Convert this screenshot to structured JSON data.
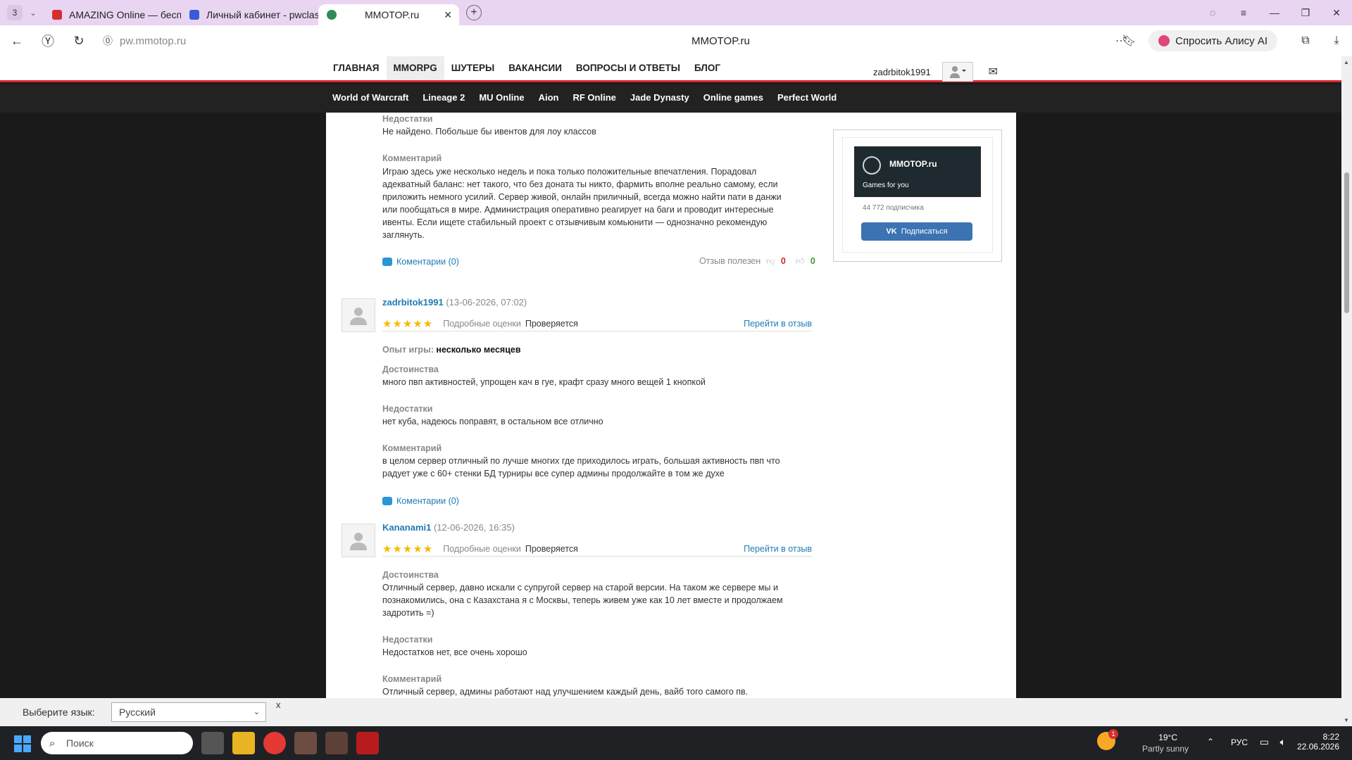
{
  "browser": {
    "tab_count": "3",
    "tabs": [
      {
        "label": "AMAZING Online — беспл",
        "fav_color": "#d32f2f"
      },
      {
        "label": "Личный кабинет - pwclas",
        "fav_color": "#3a5bd9"
      },
      {
        "label": "MMOTOP.ru",
        "fav_color": "#2e8b57"
      }
    ],
    "url": "pw.mmotop.ru",
    "page_title": "MMOTOP.ru",
    "alice_label": "Спросить Алису AI"
  },
  "site": {
    "nav": [
      "ГЛАВНАЯ",
      "MMORPG",
      "ШУТЕРЫ",
      "ВАКАНСИИ",
      "ВОПРОСЫ И ОТВЕТЫ",
      "БЛОГ"
    ],
    "username": "zadrbitok1991",
    "subnav": [
      "World of Warcraft",
      "Lineage 2",
      "MU Online",
      "Aion",
      "RF Online",
      "Jade Dynasty",
      "Online games",
      "Perfect World"
    ]
  },
  "review1": {
    "cons_label": "Недостатки",
    "cons": "Не найдено. Побольше бы ивентов для лоу классов",
    "comment_label": "Комментарий",
    "comment_lines": [
      "Играю здесь уже несколько недель и пока только положительные впечатления. Порадовал",
      "адекватный баланс: нет такого, что без доната ты никто, фармить вполне реально самому, если",
      "приложить немного усилий. Сервер живой, онлайн приличный, всегда можно найти пати в данжи",
      "или пообщаться в мире. Администрация оперативно реагирует на баги и проводит интересные",
      "ивенты. Если ищете стабильный проект с отзывчивым комьюнити — однозначно рекомендую",
      "заглянуть."
    ],
    "comments_link": "Коментарии (0)",
    "useful_label": "Отзыв полезен",
    "dislikes": "0",
    "likes": "0"
  },
  "review2": {
    "author": "zadrbitok1991",
    "date": "(13-06-2026, 07:02)",
    "stars": "★★★★★",
    "detail_label": "Подробные оценки",
    "status": "Проверяется",
    "goto": "Перейти в отзыв",
    "exp_label": "Опыт игры:",
    "exp_value": "несколько месяцев",
    "pros_label": "Достоинства",
    "pros": "много пвп активностей, упрощен кач в гуе, крафт сразу много вещей 1 кнопкой",
    "cons_label": "Недостатки",
    "cons": "нет куба, надеюсь поправят, в остальном все отлично",
    "comment_label": "Комментарий",
    "comment_lines": [
      "в целом сервер отличный по лучше многих где приходилось играть, большая активность пвп что",
      "радует уже с 60+ стенки БД турниры все супер админы продолжайте в том же духе"
    ],
    "comments_link": "Коментарии (0)"
  },
  "review3": {
    "author": "Kananami1",
    "date": "(12-06-2026, 16:35)",
    "stars": "★★★★★",
    "detail_label": "Подробные оценки",
    "status": "Проверяется",
    "goto": "Перейти в отзыв",
    "pros_label": "Достоинства",
    "pros_lines": [
      "Отличный сервер, давно искали с супругой сервер на старой версии. На таком же сервере мы и",
      "познакомились, она с Казахстана я с Москвы, теперь живем уже как 10 лет вместе и продолжаем",
      "задротить =)"
    ],
    "cons_label": "Недостатки",
    "cons": "Недостатков нет, все очень хорошо",
    "comment_label": "Комментарий",
    "comment": "Отличный сервер, админы работают над улучшением каждый день, вайб того самого пв."
  },
  "widget": {
    "name": "MMOTOP.ru",
    "slogan": "Games for you",
    "subscribers": "44 772 подписчика",
    "button": "Подписаться"
  },
  "langbar": {
    "label": "Выберите язык:",
    "selected": "Русский",
    "close": "x"
  },
  "taskbar": {
    "search_placeholder": "Поиск",
    "temp": "19°C",
    "weather": "Partly sunny",
    "lang": "РУС",
    "time": "8:22",
    "date": "22.06.2026",
    "weather_badge": "1"
  }
}
